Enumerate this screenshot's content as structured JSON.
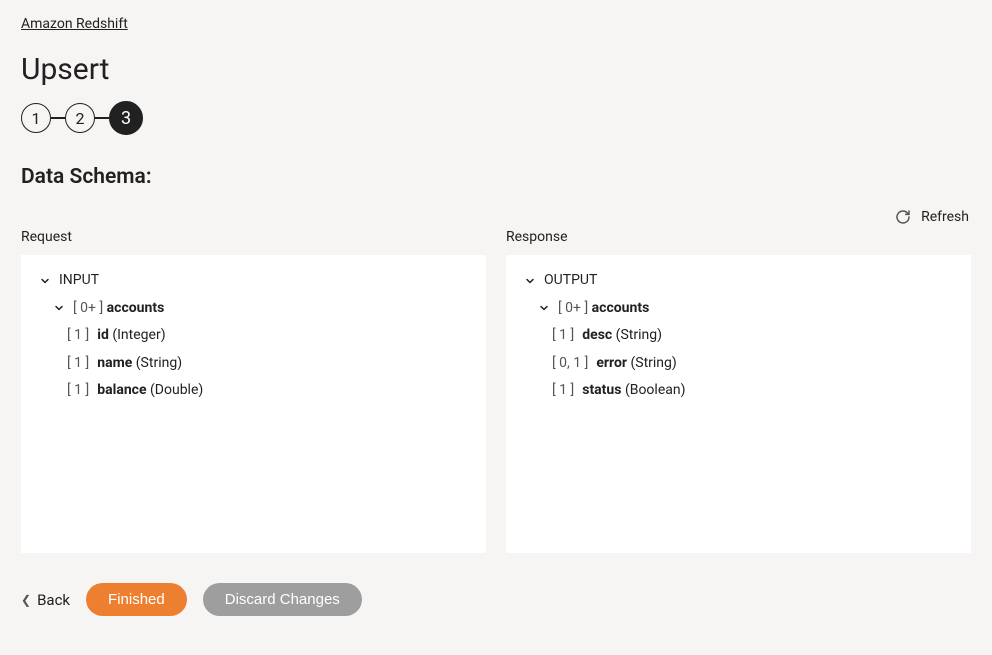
{
  "breadcrumb": {
    "label": "Amazon Redshift"
  },
  "title": "Upsert",
  "steps": {
    "s1": "1",
    "s2": "2",
    "s3": "3",
    "activeIndex": 3
  },
  "section": {
    "title": "Data Schema:"
  },
  "refresh": {
    "label": "Refresh"
  },
  "request": {
    "heading": "Request",
    "root": "INPUT",
    "group": {
      "card": "[ 0+ ]",
      "name": "accounts"
    },
    "fields": [
      {
        "card": "[ 1 ]",
        "name": "id",
        "type": "(Integer)"
      },
      {
        "card": "[ 1 ]",
        "name": "name",
        "type": "(String)"
      },
      {
        "card": "[ 1 ]",
        "name": "balance",
        "type": "(Double)"
      }
    ]
  },
  "response": {
    "heading": "Response",
    "root": "OUTPUT",
    "group": {
      "card": "[ 0+ ]",
      "name": "accounts"
    },
    "fields": [
      {
        "card": "[ 1 ]",
        "name": "desc",
        "type": "(String)"
      },
      {
        "card": "[ 0, 1 ]",
        "name": "error",
        "type": "(String)"
      },
      {
        "card": "[ 1 ]",
        "name": "status",
        "type": "(Boolean)"
      }
    ]
  },
  "footer": {
    "back": "Back",
    "finished": "Finished",
    "discard": "Discard Changes"
  }
}
